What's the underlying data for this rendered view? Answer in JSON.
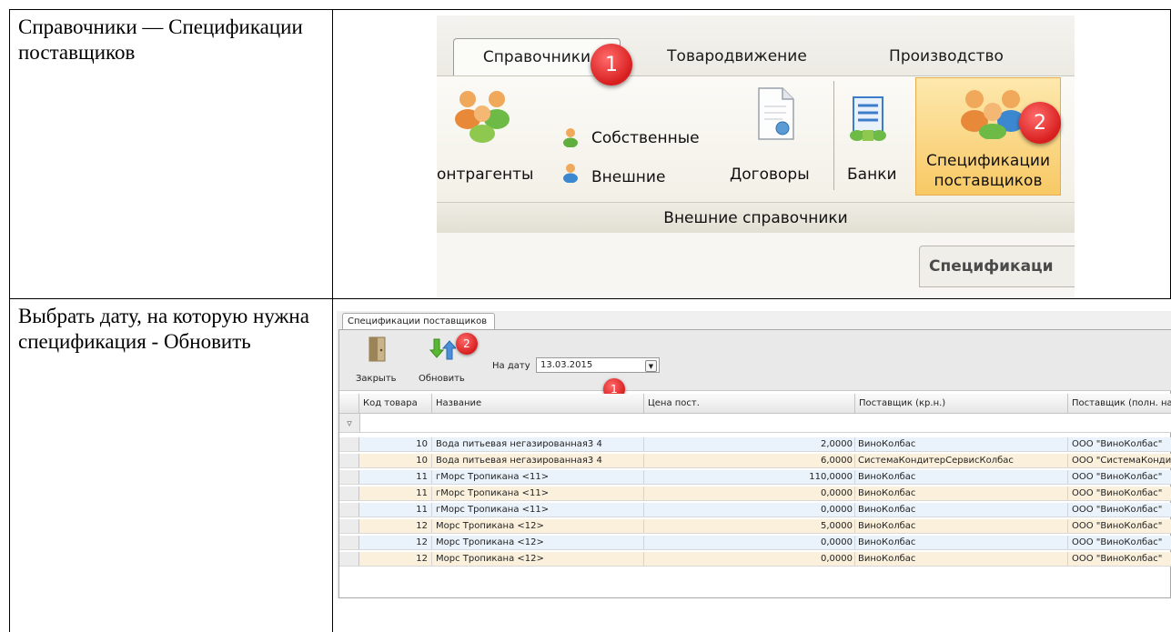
{
  "instructions": {
    "row1": "Справочники — Спецификации поставщиков",
    "row2": "Выбрать дату, на которую нужна спецификация - Обновить"
  },
  "ribbon": {
    "tabs": [
      {
        "label": "Справочники",
        "active": true
      },
      {
        "label": "Товародвижение",
        "active": false
      },
      {
        "label": "Производство",
        "active": false
      }
    ],
    "buttons": {
      "contractors": "онтрагенты",
      "own": "Собственные",
      "external": "Внешние",
      "contracts": "Договоры",
      "banks": "Банки",
      "spec_line1": "Спецификации",
      "spec_line2": "поставщиков"
    },
    "group_label": "Внешние справочники",
    "open_tab": "Спецификаци",
    "badge1": "1",
    "badge2": "2"
  },
  "window": {
    "tab_title": "Спецификации поставщиков",
    "close_label": "Закрыть",
    "refresh_label": "Обновить",
    "date_label": "На дату",
    "date_value": "13.03.2015",
    "badge1": "1",
    "badge2": "2",
    "filter_icon": "▿"
  },
  "grid": {
    "columns": [
      "Код товара",
      "Название",
      "Цена пост.",
      "Поставщик (кр.н.)",
      "Поставщик (полн. на"
    ],
    "rows": [
      [
        "10",
        "Вода питьевая негазированная3 4",
        "2,0000",
        "ВиноКолбас",
        "ООО \"ВиноКолбас\""
      ],
      [
        "10",
        "Вода питьевая негазированная3 4",
        "6,0000",
        "СистемаКондитерСервисКолбас",
        "ООО \"СистемаКонди"
      ],
      [
        "11",
        "гМорс Тропикана  <11>",
        "110,0000",
        "ВиноКолбас",
        "ООО \"ВиноКолбас\""
      ],
      [
        "11",
        "гМорс Тропикана  <11>",
        "0,0000",
        "ВиноКолбас",
        "ООО \"ВиноКолбас\""
      ],
      [
        "11",
        "гМорс Тропикана  <11>",
        "0,0000",
        "ВиноКолбас",
        "ООО \"ВиноКолбас\""
      ],
      [
        "12",
        "Морс Тропикана  <12>",
        "5,0000",
        "ВиноКолбас",
        "ООО \"ВиноКолбас\""
      ],
      [
        "12",
        "Морс Тропикана  <12>",
        "0,0000",
        "ВиноКолбас",
        "ООО \"ВиноКолбас\""
      ],
      [
        "12",
        "Морс Тропикана  <12>",
        "0,0000",
        "ВиноКолбас",
        "ООО \"ВиноКолбас\""
      ]
    ],
    "row_colors": [
      "#eaf3fb",
      "#fbf0dc"
    ]
  },
  "colors": {
    "badge": "#d81e1e",
    "active_button": "#f8c965"
  }
}
